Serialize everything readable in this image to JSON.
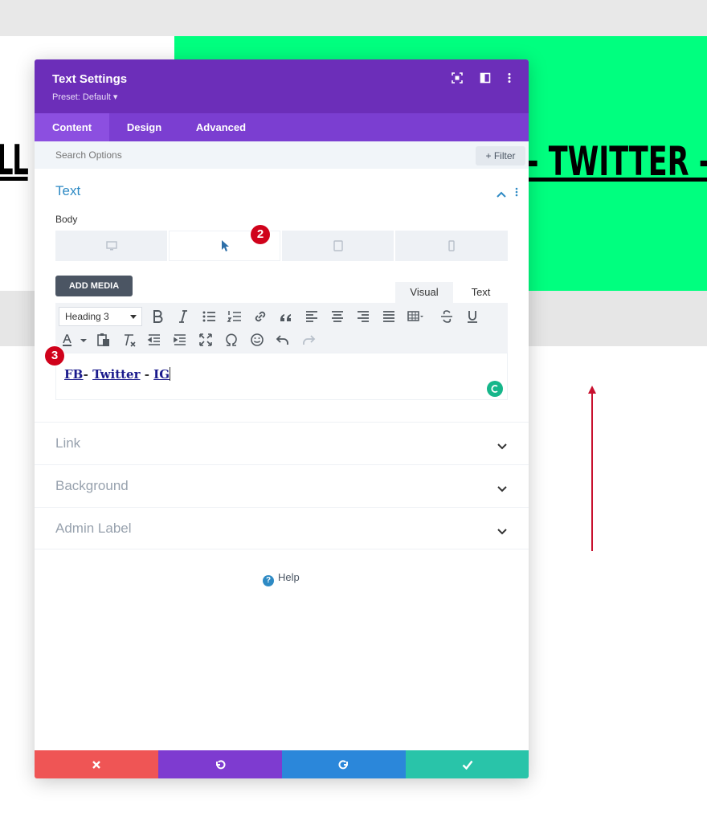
{
  "background": {
    "left_heading": "LL",
    "right_heading": "- TWITTER -",
    "colors": {
      "green": "#00ff7f",
      "arrow": "#c8102e"
    }
  },
  "modal": {
    "title": "Text Settings",
    "preset": "Preset: Default ▾",
    "header_icons": [
      "focus-icon",
      "split-view-icon",
      "more-options-icon"
    ],
    "tabs": [
      {
        "label": "Content",
        "active": true
      },
      {
        "label": "Design",
        "active": false
      },
      {
        "label": "Advanced",
        "active": false
      }
    ],
    "search_placeholder": "Search Options",
    "filter_label": "+ Filter",
    "section": {
      "title": "Text",
      "body_label": "Body",
      "devices": [
        "desktop-icon",
        "hover-cursor-icon",
        "tablet-icon",
        "phone-icon"
      ],
      "add_media_label": "ADD MEDIA",
      "editor_tabs": {
        "visual": "Visual",
        "text": "Text"
      },
      "heading_select": "Heading 3",
      "content": {
        "link1": "FB",
        "sep1": "- ",
        "link2": "Twitter",
        "sep2": " - ",
        "link3": "IG"
      }
    },
    "collapsed_sections": [
      "Link",
      "Background",
      "Admin Label"
    ],
    "help_label": "Help",
    "colors": {
      "header": "#6c2eb9",
      "tabs": "#7b3ed1",
      "accent": "#2e8ac4",
      "cancel": "#ef5555",
      "undo": "#7e3bd0",
      "redo": "#2b87da",
      "save": "#29c4a9"
    }
  },
  "badges": {
    "two": "2",
    "three": "3"
  }
}
